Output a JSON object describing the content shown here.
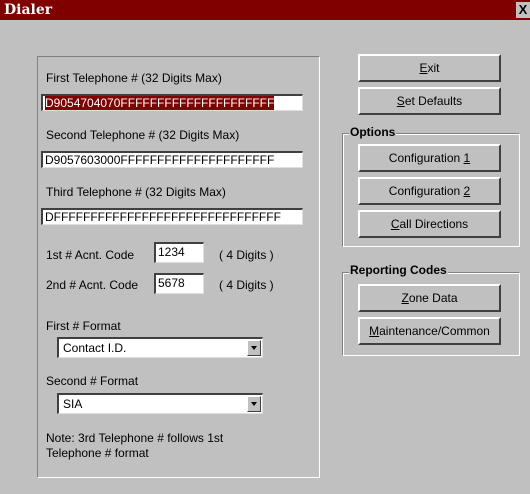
{
  "window": {
    "title": "Dialer",
    "close_glyph": "X"
  },
  "phones": {
    "first_label": "First Telephone # (32 Digits Max)",
    "first_value": "D9054704070FFFFFFFFFFFFFFFFFFFFF",
    "second_label": "Second Telephone # (32 Digits Max)",
    "second_value": "D9057603000FFFFFFFFFFFFFFFFFFFFF",
    "third_label": "Third Telephone # (32 Digits Max)",
    "third_value": "DFFFFFFFFFFFFFFFFFFFFFFFFFFFFFFF"
  },
  "accounts": {
    "first_label": "1st # Acnt. Code",
    "first_value": "1234",
    "first_hint": "( 4 Digits )",
    "second_label": "2nd # Acnt. Code",
    "second_value": "5678",
    "second_hint": "( 4 Digits )"
  },
  "formats": {
    "first_label": "First # Format",
    "first_value": "Contact I.D.",
    "second_label": "Second # Format",
    "second_value": "SIA"
  },
  "note": {
    "line1": "Note: 3rd Telephone # follows 1st",
    "line2": "Telephone # format"
  },
  "buttons": {
    "exit": {
      "pre": "",
      "key": "E",
      "post": "xit"
    },
    "set_defaults": {
      "pre": "",
      "key": "S",
      "post": "et Defaults"
    },
    "configuration_1": {
      "pre": "Configuration ",
      "key": "1",
      "post": ""
    },
    "configuration_2": {
      "pre": "Configuration ",
      "key": "2",
      "post": ""
    },
    "call_directions": {
      "pre": "",
      "key": "C",
      "post": "all Directions"
    },
    "zone_data": {
      "pre": "",
      "key": "Z",
      "post": "one Data"
    },
    "maintenance": {
      "pre": "",
      "key": "M",
      "post": "aintenance/Common"
    }
  },
  "groups": {
    "options": "Options",
    "reporting_codes": "Reporting Codes"
  },
  "icons": {
    "close": "close-icon",
    "dropdown": "chevron-down-icon"
  },
  "colors": {
    "titlebar": "#800000",
    "face": "#c0c0c0",
    "selection": "#800000"
  }
}
